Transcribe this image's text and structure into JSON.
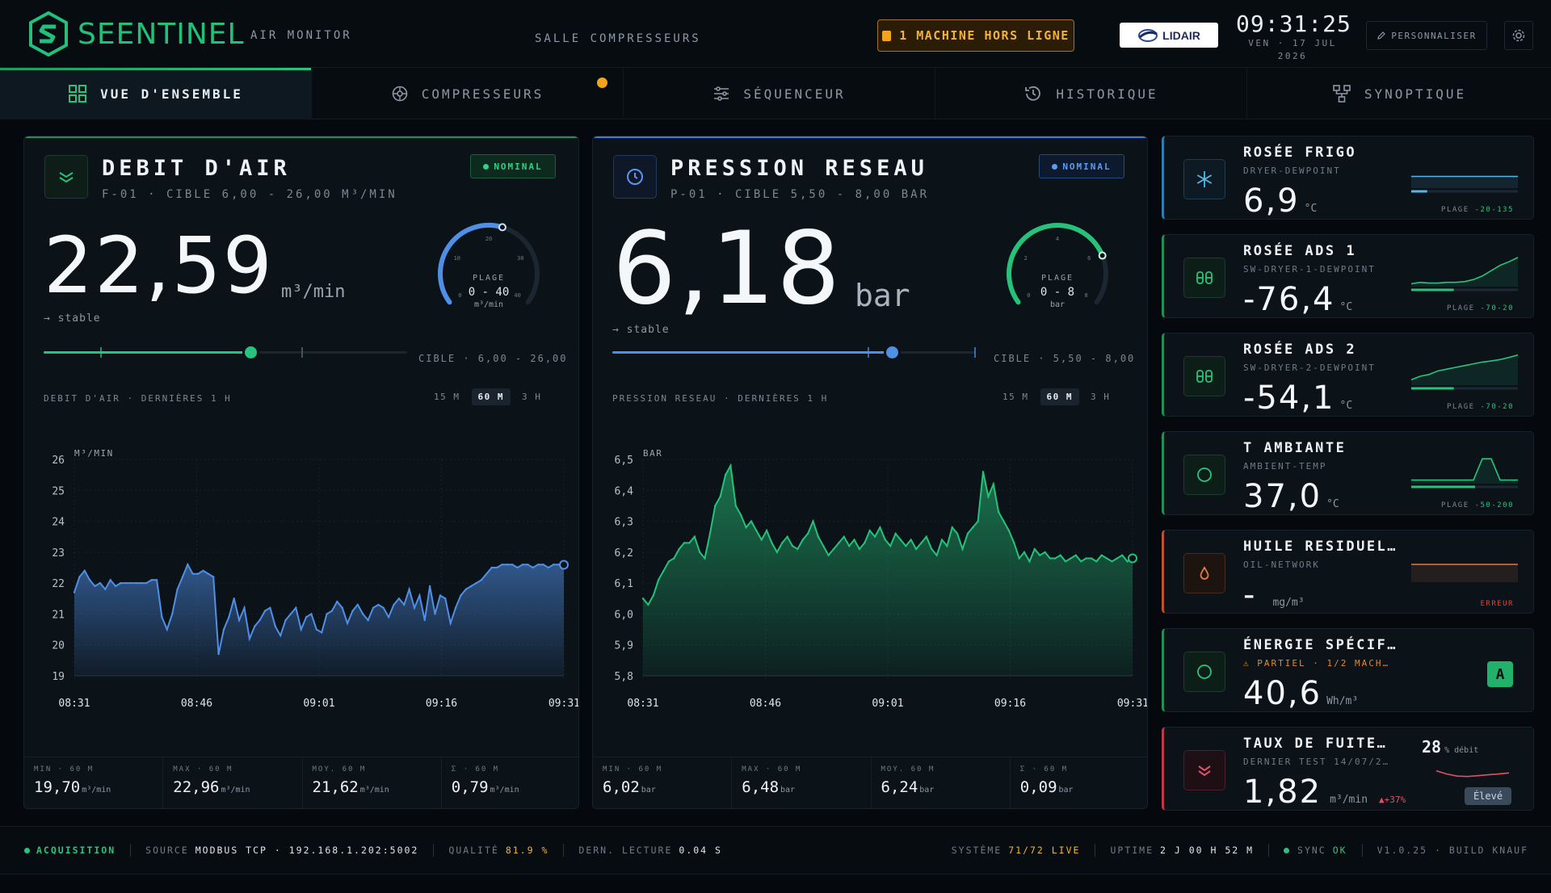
{
  "header": {
    "brand": "SEENTINEL",
    "subtitle": "AIR MONITOR",
    "location": "SALLE COMPRESSEURS",
    "alert": "1 MACHINE HORS LIGNE",
    "partner_logo": "LIDAIR",
    "time": "09:31:25",
    "date_line1": "VEN · 17 JUL",
    "date_line2": "2026",
    "personalize": "PERSONNALISER",
    "icons": {
      "logo": "seentinel-logo-icon",
      "settings": "gear-icon",
      "edit": "pencil-icon"
    }
  },
  "tabs": [
    {
      "label": "VUE D'ENSEMBLE",
      "active": true,
      "icon": "grid-icon"
    },
    {
      "label": "COMPRESSEURS",
      "active": false,
      "icon": "compressor-icon",
      "has_dot": true
    },
    {
      "label": "SÉQUENCEUR",
      "active": false,
      "icon": "sliders-icon"
    },
    {
      "label": "HISTORIQUE",
      "active": false,
      "icon": "history-icon"
    },
    {
      "label": "SYNOPTIQUE",
      "active": false,
      "icon": "network-icon"
    }
  ],
  "flow": {
    "title": "DEBIT D'AIR",
    "subtitle": "F-01 · CIBLE 6,00 - 26,00 M³/MIN",
    "status": "NOMINAL",
    "value": "22,59",
    "unit": "m³/min",
    "trend": "→ stable",
    "gauge_label": "PLAGE",
    "gauge_range": "0 - 40",
    "gauge_unit": "m³/min",
    "gauge_ticks": [
      "0",
      "10",
      "20",
      "30",
      "40"
    ],
    "gauge_fraction": 0.565,
    "slider_fraction": 0.57,
    "target": "CIBLE · 6,00 - 26,00",
    "chart_label": "DEBIT D'AIR · DERNIÈRES 1 H",
    "ranges": [
      "15 M",
      "60 M",
      "3 H"
    ],
    "active_range": "60 M",
    "stats": [
      {
        "label": "MIN · 60 M",
        "value": "19,70",
        "unit": "m³/min"
      },
      {
        "label": "MAX · 60 M",
        "value": "22,96",
        "unit": "m³/min"
      },
      {
        "label": "MOY. 60 M",
        "value": "21,62",
        "unit": "m³/min"
      },
      {
        "label": "Σ · 60 M",
        "value": "0,79",
        "unit": "m³/min"
      }
    ]
  },
  "pressure": {
    "title": "PRESSION RESEAU",
    "subtitle": "P-01 · CIBLE 5,50 - 8,00 BAR",
    "status": "NOMINAL",
    "value": "6,18",
    "unit": "bar",
    "trend": "→ stable",
    "gauge_label": "PLAGE",
    "gauge_range": "0 - 8",
    "gauge_unit": "bar",
    "gauge_ticks": [
      "0",
      "2",
      "4",
      "6",
      "8"
    ],
    "gauge_fraction": 0.77,
    "slider_fraction": 0.77,
    "target": "CIBLE · 5,50 - 8,00",
    "chart_label": "PRESSION RESEAU · DERNIÈRES 1 H",
    "ranges": [
      "15 M",
      "60 M",
      "3 H"
    ],
    "active_range": "60 M",
    "stats": [
      {
        "label": "MIN · 60 M",
        "value": "6,02",
        "unit": "bar"
      },
      {
        "label": "MAX · 60 M",
        "value": "6,48",
        "unit": "bar"
      },
      {
        "label": "MOY. 60 M",
        "value": "6,24",
        "unit": "bar"
      },
      {
        "label": "Σ · 60 M",
        "value": "0,09",
        "unit": "bar"
      }
    ]
  },
  "chart_data": [
    {
      "type": "area",
      "ylabel": "M³/MIN",
      "ylim": [
        19,
        26
      ],
      "yticks": [
        "26",
        "25",
        "24",
        "23",
        "22",
        "21",
        "20",
        "19"
      ],
      "x_ticks": [
        "08:31",
        "08:46",
        "09:01",
        "09:16",
        "09:31"
      ],
      "color": "#4f8fe6",
      "values": [
        21.7,
        22.2,
        22.4,
        22.1,
        21.9,
        22.0,
        21.8,
        22.1,
        21.9,
        22.0,
        22.0,
        22.0,
        22.0,
        22.0,
        22.0,
        22.1,
        22.1,
        20.9,
        20.5,
        21.0,
        21.8,
        22.2,
        22.6,
        22.3,
        22.3,
        22.4,
        22.3,
        22.2,
        19.7,
        20.5,
        20.9,
        21.5,
        20.8,
        21.2,
        20.2,
        20.6,
        20.8,
        21.1,
        21.2,
        20.6,
        20.3,
        20.8,
        21.0,
        21.2,
        20.5,
        20.9,
        21.0,
        20.5,
        20.4,
        21.0,
        21.1,
        21.4,
        21.2,
        20.7,
        21.1,
        21.3,
        21.0,
        20.8,
        21.2,
        21.3,
        21.2,
        20.9,
        21.3,
        21.5,
        21.3,
        21.8,
        21.2,
        21.6,
        20.8,
        21.9,
        21.0,
        21.6,
        21.5,
        20.7,
        21.2,
        21.6,
        21.8,
        21.9,
        22.0,
        22.1,
        22.3,
        22.5,
        22.5,
        22.6,
        22.6,
        22.6,
        22.5,
        22.6,
        22.6,
        22.5,
        22.6,
        22.6,
        22.5,
        22.6,
        22.6,
        22.59
      ]
    },
    {
      "type": "area",
      "ylabel": "BAR",
      "ylim": [
        5.8,
        6.5
      ],
      "yticks": [
        "6,5",
        "6,4",
        "6,3",
        "6,2",
        "6,1",
        "6,0",
        "5,9",
        "5,8"
      ],
      "x_ticks": [
        "08:31",
        "08:46",
        "09:01",
        "09:16",
        "09:31"
      ],
      "color": "#26c27a",
      "values": [
        6.05,
        6.03,
        6.06,
        6.11,
        6.14,
        6.17,
        6.18,
        6.21,
        6.23,
        6.23,
        6.25,
        6.2,
        6.18,
        6.26,
        6.35,
        6.38,
        6.45,
        6.48,
        6.35,
        6.32,
        6.28,
        6.3,
        6.27,
        6.24,
        6.27,
        6.23,
        6.2,
        6.23,
        6.25,
        6.22,
        6.21,
        6.24,
        6.26,
        6.3,
        6.25,
        6.22,
        6.19,
        6.21,
        6.23,
        6.25,
        6.22,
        6.24,
        6.21,
        6.23,
        6.27,
        6.25,
        6.28,
        6.24,
        6.22,
        6.26,
        6.24,
        6.22,
        6.24,
        6.21,
        6.23,
        6.25,
        6.21,
        6.19,
        6.24,
        6.22,
        6.28,
        6.26,
        6.21,
        6.26,
        6.28,
        6.3,
        6.46,
        6.38,
        6.42,
        6.33,
        6.3,
        6.27,
        6.23,
        6.18,
        6.2,
        6.17,
        6.21,
        6.19,
        6.2,
        6.18,
        6.18,
        6.19,
        6.17,
        6.18,
        6.19,
        6.17,
        6.18,
        6.18,
        6.17,
        6.19,
        6.18,
        6.17,
        6.18,
        6.19,
        6.17,
        6.18
      ]
    }
  ],
  "cards": [
    {
      "title": "ROSÉE FRIGO",
      "sub": "DRYER-DEWPOINT",
      "value": "6,9",
      "unit": "°C",
      "plage_label": "PLAGE",
      "plage": "-20-135",
      "icon": "snowflake-icon",
      "accent": "#1f8f5c",
      "plage_color": "#28c47e",
      "spark": [
        0.33,
        0.33,
        0.33,
        0.33,
        0.33,
        0.33,
        0.33,
        0.33,
        0.33,
        0.33,
        0.33
      ],
      "base": 0.15
    },
    {
      "title": "ROSÉE ADS 1",
      "sub": "SW-DRYER-1-DEWPOINT",
      "value": "-76,4",
      "unit": "°C",
      "plage_label": "PLAGE",
      "plage": "-70-20",
      "icon": "dryer-icon",
      "accent": "#1f8f5c",
      "plage_color": "#28c47e",
      "spark": [
        0.08,
        0.12,
        0.1,
        0.1,
        0.12,
        0.12,
        0.14,
        0.2,
        0.3,
        0.45,
        0.6,
        0.7,
        0.82
      ],
      "base": 0.4
    },
    {
      "title": "ROSÉE ADS 2",
      "sub": "SW-DRYER-2-DEWPOINT",
      "value": "-54,1",
      "unit": "°C",
      "plage_label": "PLAGE",
      "plage": "-70-20",
      "icon": "dryer-icon",
      "accent": "#1f8f5c",
      "plage_color": "#28c47e",
      "spark": [
        0.15,
        0.25,
        0.3,
        0.4,
        0.45,
        0.5,
        0.55,
        0.6,
        0.65,
        0.68,
        0.72,
        0.78,
        0.85
      ],
      "base": 0.4
    },
    {
      "title": "T AMBIANTE",
      "sub": "AMBIENT-TEMP",
      "value": "37,0",
      "unit": "°C",
      "plage_label": "PLAGE",
      "plage": "-50-200",
      "icon": "circle-icon",
      "accent": "#1f8f5c",
      "plage_color": "#28c47e",
      "spark": [
        0.1,
        0.1,
        0.1,
        0.1,
        0.1,
        0.1,
        0.1,
        0.1,
        0.7,
        0.7,
        0.1,
        0.1,
        0.1
      ],
      "base": 0.6
    },
    {
      "title": "HUILE RESIDUEL…",
      "sub": "OIL-NETWORK",
      "value": "-",
      "unit": "mg/m³",
      "plage_label": "",
      "plage": "ERREUR",
      "icon": "oil-drop-icon",
      "accent": "#c0502e",
      "plage_color": "#d9453b",
      "spark": [
        0.5,
        0.5,
        0.5,
        0.5,
        0.5,
        0.5,
        0.5,
        0.5,
        0.5,
        0.5,
        0.5
      ],
      "base": 0
    },
    {
      "title": "ÉNERGIE SPÉCIF…",
      "sub": "⚠ PARTIEL · 1/2 MACH…",
      "value": "40,6",
      "unit": "Wh/m³",
      "grade": "A",
      "icon": "circle-icon",
      "accent": "#1f8f5c"
    },
    {
      "title": "TAUX DE FUITE…",
      "sub": "DERNIER TEST 14/07/2…",
      "value": "1,82",
      "unit": "m³/min",
      "pct_value": "28",
      "pct_unit": "% débit",
      "delta": "▲+37%",
      "level": "Élevé",
      "icon": "chevrons-down-icon",
      "accent": "#c0364a",
      "spark": [
        0.55,
        0.4,
        0.3,
        0.28,
        0.32,
        0.36,
        0.4,
        0.45
      ]
    }
  ],
  "footer": {
    "acquisition": "ACQUISITION",
    "source_label": "SOURCE",
    "source": "MODBUS TCP · 192.168.1.202:5002",
    "quality_label": "QUALITÉ",
    "quality": "81.9 %",
    "last_label": "DERN. LECTURE",
    "last": "0.04 S",
    "system_label": "SYSTÈME",
    "system": "71/72 LIVE",
    "uptime_label": "UPTIME",
    "uptime": "2 J 00 H 52 M",
    "sync_label": "SYNC",
    "sync": "OK",
    "version": "V1.0.25 · BUILD KNAUF"
  }
}
